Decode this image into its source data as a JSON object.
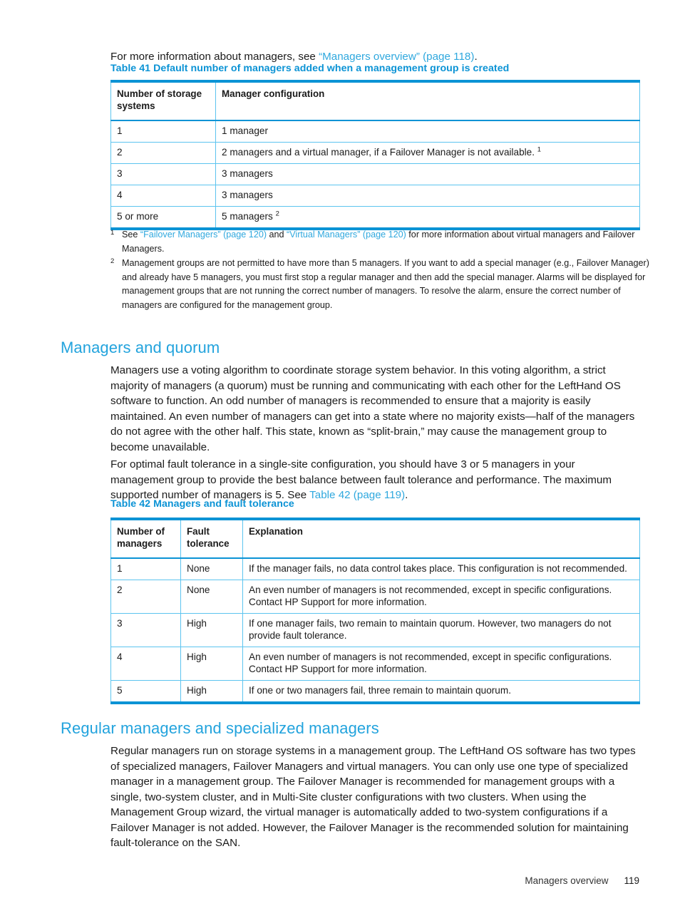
{
  "intro": {
    "prefix": "For more information about managers, see ",
    "link": "“Managers overview” (page 118)",
    "suffix": "."
  },
  "table41": {
    "caption": "Table 41 Default number of managers added when a management group is created",
    "headers": [
      "Number of storage systems",
      "Manager configuration"
    ],
    "rows": [
      {
        "c0": "1",
        "c1": "1 manager",
        "fn": ""
      },
      {
        "c0": "2",
        "c1": "2 managers and a virtual manager, if a Failover Manager is not available.",
        "fn": "1"
      },
      {
        "c0": "3",
        "c1": "3 managers",
        "fn": ""
      },
      {
        "c0": "4",
        "c1": "3 managers",
        "fn": ""
      },
      {
        "c0": "5 or more",
        "c1": "5 managers",
        "fn": "2"
      }
    ]
  },
  "footnotes": {
    "one": {
      "marker": "1",
      "part1": "See ",
      "link1": "“Failover Managers” (page 120)",
      "part2": " and ",
      "link2": "“Virtual Managers” (page 120)",
      "part3": " for more information about virtual managers and Failover Managers."
    },
    "two": {
      "marker": "2",
      "text": "Management groups are not permitted to have more than 5 managers. If you want to add a special manager (e.g., Failover Manager) and already have 5 managers, you must first stop a regular manager and then add the special manager. Alarms will be displayed for management groups that are not running the correct number of managers. To resolve the alarm, ensure the correct number of managers are configured for the management group."
    }
  },
  "section_quorum": {
    "heading": "Managers and quorum",
    "para1": "Managers use a voting algorithm to coordinate storage system behavior. In this voting algorithm, a strict majority of managers (a quorum) must be running and communicating with each other for the LeftHand OS software to function. An odd number of managers is recommended to ensure that a majority is easily maintained. An even number of managers can get into a state where no majority exists—half of the managers do not agree with the other half. This state, known as “split-brain,” may cause the management group to become unavailable.",
    "para2_prefix": "For optimal fault tolerance in a single-site configuration, you should have 3 or 5 managers in your management group to provide the best balance between fault tolerance and performance. The maximum supported number of managers is 5. See ",
    "para2_link": "Table 42 (page 119)",
    "para2_suffix": "."
  },
  "table42": {
    "caption": "Table 42 Managers and fault tolerance",
    "headers": [
      "Number of managers",
      "Fault tolerance",
      "Explanation"
    ],
    "rows": [
      {
        "c0": "1",
        "c1": "None",
        "c2": "If the manager fails, no data control takes place. This configuration is not recommended."
      },
      {
        "c0": "2",
        "c1": "None",
        "c2": "An even number of managers is not recommended, except in specific configurations. Contact HP Support for more information."
      },
      {
        "c0": "3",
        "c1": "High",
        "c2": "If one manager fails, two remain to maintain quorum. However, two managers do not provide fault tolerance."
      },
      {
        "c0": "4",
        "c1": "High",
        "c2": "An even number of managers is not recommended, except in specific configurations. Contact HP Support for more information."
      },
      {
        "c0": "5",
        "c1": "High",
        "c2": "If one or two managers fail, three remain to maintain quorum."
      }
    ]
  },
  "section_regular": {
    "heading": "Regular managers and specialized managers",
    "para1": "Regular managers run on storage systems in a management group. The LeftHand OS software has two types of specialized managers, Failover Managers and virtual managers. You can only use one type of specialized manager in a management group. The Failover Manager is recommended for management groups with a single, two-system cluster, and in Multi-Site cluster configurations with two clusters. When using the Management Group wizard, the virtual manager is automatically added to two-system configurations if a Failover Manager is not added. However, the Failover Manager is the recommended solution for maintaining fault-tolerance on the SAN."
  },
  "footer": {
    "chapter": "Managers overview",
    "page": "119"
  },
  "colors": {
    "link": "#2fa8de",
    "caption": "#0b93d5",
    "heading": "#22a3dd",
    "table_border": "#5cc4ef",
    "table_rule": "#0b93d5"
  }
}
